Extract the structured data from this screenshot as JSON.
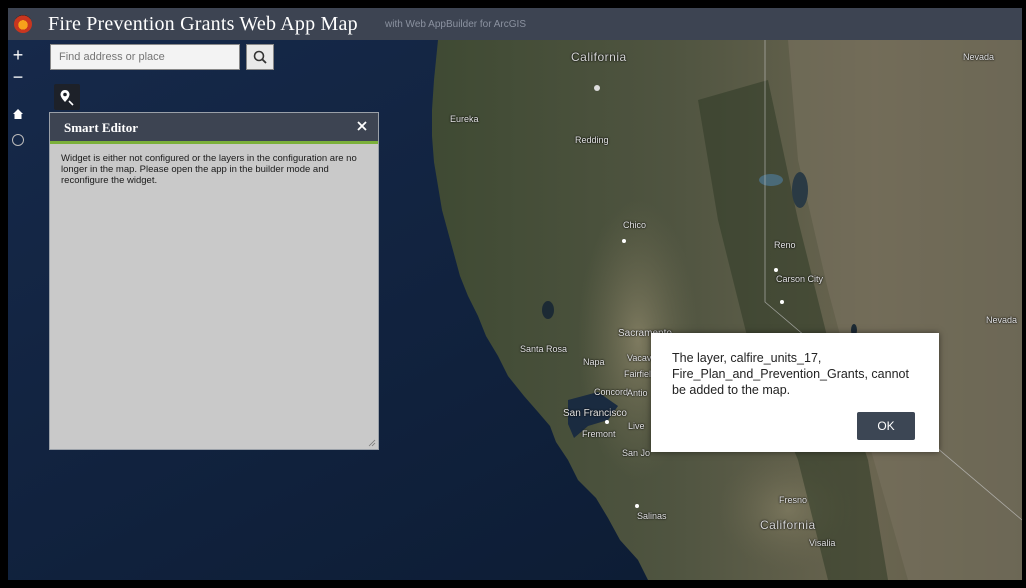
{
  "header": {
    "title": "Fire Prevention Grants Web App Map",
    "subtitle": "with Web AppBuilder for ArcGIS"
  },
  "search": {
    "placeholder": "Find address or place"
  },
  "controls": {
    "zoom_in": "+",
    "zoom_out": "−"
  },
  "icons": {
    "logo": "fire-logo-icon",
    "search": "search-icon",
    "locate": "locate-pin-icon",
    "home": "home-icon",
    "circle": "circle-icon",
    "close": "close-icon"
  },
  "panel": {
    "title": "Smart Editor",
    "message": "Widget is either not configured or the layers in the configuration are no longer in the map. Please open the app in the builder mode and reconfigure the widget."
  },
  "dialog": {
    "message": "The layer, calfire_units_17, Fire_Plan_and_Prevention_Grants, cannot be added to the map.",
    "ok_label": "OK"
  },
  "places": {
    "california_top": "California",
    "nevada_top": "Nevada",
    "eureka": "Eureka",
    "redding": "Redding",
    "chico": "Chico",
    "reno": "Reno",
    "carson_city": "Carson City",
    "nevada_right": "Nevada",
    "sacramento": "Sacramento",
    "santa_rosa": "Santa Rosa",
    "napa": "Napa",
    "vacaville": "Vacavile",
    "fairfield": "Fairfield",
    "concord": "Concord",
    "antioch": "Antio",
    "san_francisco": "San Francisco",
    "livermore": "Live",
    "fremont": "Fremont",
    "san_jose": "San Jo",
    "salinas": "Salinas",
    "fresno": "Fresno",
    "california_bottom": "California",
    "visalia": "Visalia"
  },
  "colors": {
    "header_bg": "#3d4452",
    "panel_accent": "#7bb03a",
    "ok_button": "#3c4654",
    "ocean": "#0d1f38"
  }
}
